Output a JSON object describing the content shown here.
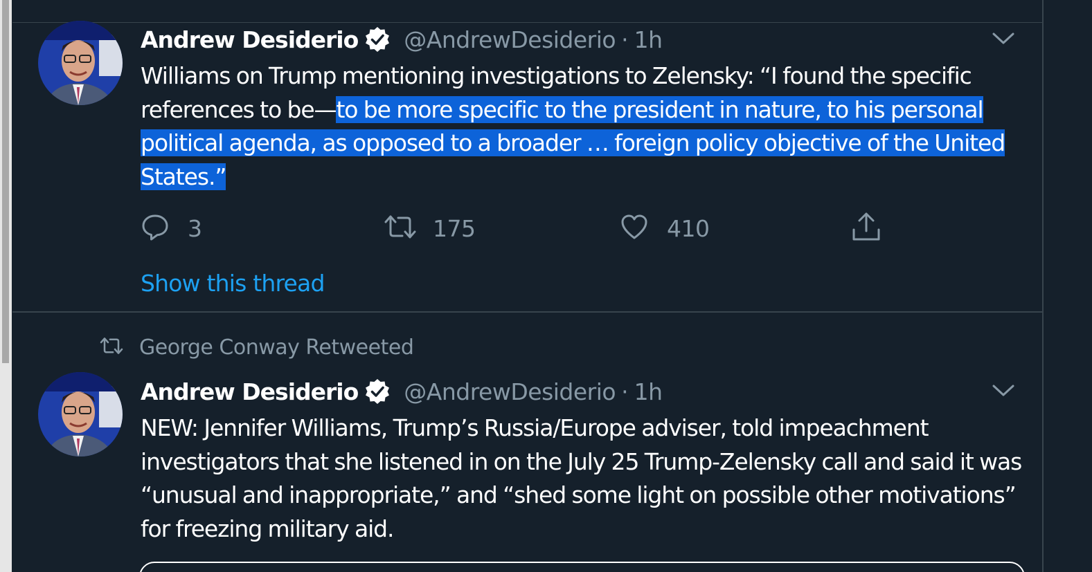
{
  "tweets": [
    {
      "author_name": "Andrew Desiderio",
      "handle": "@AndrewDesiderio",
      "separator": "·",
      "time": "1h",
      "text_plain": "Williams on Trump mentioning investigations to Zelensky: “I found the specific references to be—",
      "text_selected": "to be more specific to the president in nature, to his personal political agenda, as opposed to a broader … foreign policy objective of the United States.”",
      "reply_count": "3",
      "retweet_count": "175",
      "like_count": "410",
      "show_thread": "Show this thread"
    },
    {
      "retweeted_by": "George Conway Retweeted",
      "author_name": "Andrew Desiderio",
      "handle": "@AndrewDesiderio",
      "separator": "·",
      "time": "1h",
      "text": "NEW: Jennifer Williams, Trump’s Russia/Europe adviser, told impeachment investigators that she listened in on the July 25 Trump-Zelensky call and said it was “unusual and inappropriate,” and “shed some light on possible other motivations” for freezing military aid."
    }
  ],
  "icons": {
    "verified": "verified-badge-icon",
    "more": "chevron-down-icon",
    "reply": "reply-icon",
    "retweet": "retweet-icon",
    "like": "heart-icon",
    "share": "share-icon"
  },
  "colors": {
    "background": "#15202b",
    "divider": "#38444d",
    "primary_text": "#ffffff",
    "secondary_text": "#8899a6",
    "link": "#1da1f2",
    "selection": "#0d63d9"
  }
}
